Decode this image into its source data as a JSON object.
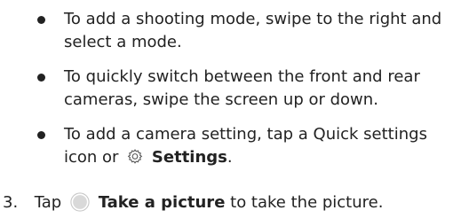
{
  "bullets": [
    {
      "text": "To add a shooting mode, swipe to the right and select a mode."
    },
    {
      "text": "To quickly switch between the front and rear cameras, swipe the screen up or down."
    },
    {
      "text_before": "To add a camera setting, tap a Quick settings icon or",
      "link": "Settings",
      "text_after": "."
    }
  ],
  "step": {
    "number": "3.",
    "prefix": "Tap",
    "action": "Take a picture",
    "suffix": "to take the picture."
  },
  "icons": {
    "settings": "gear-icon",
    "shutter": "shutter-button-icon"
  }
}
